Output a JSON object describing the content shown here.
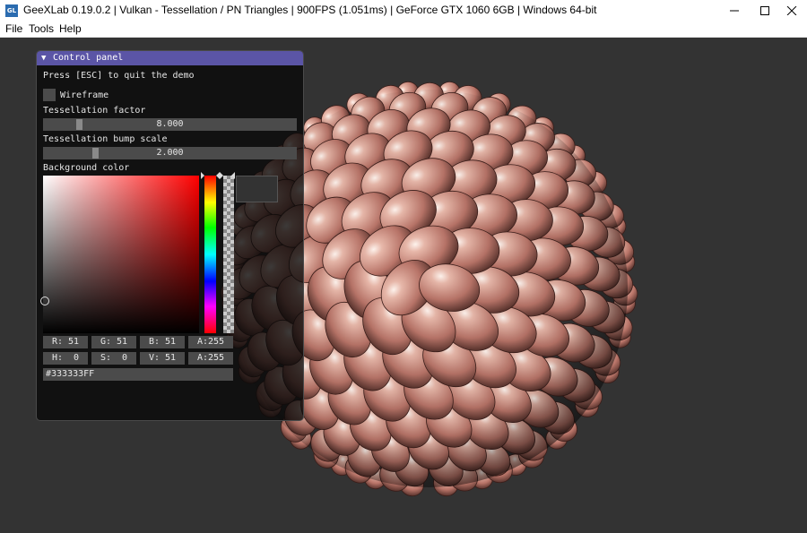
{
  "window": {
    "app_icon_text": "GL",
    "title": "GeeXLab 0.19.0.2 | Vulkan - Tessellation / PN Triangles | 900FPS (1.051ms) | GeForce GTX 1060 6GB | Windows 64-bit"
  },
  "menu": {
    "items": [
      {
        "label": "File"
      },
      {
        "label": "Tools"
      },
      {
        "label": "Help"
      }
    ]
  },
  "control_panel": {
    "title": "Control panel",
    "collapse_arrow": "▼",
    "hint": "Press [ESC] to quit the demo",
    "wireframe": {
      "label": "Wireframe",
      "checked": false
    },
    "tessellation_factor": {
      "label": "Tessellation factor",
      "value": "8.000",
      "fraction": 0.133
    },
    "tessellation_bump_scale": {
      "label": "Tessellation bump scale",
      "value": "2.000",
      "fraction": 0.2
    },
    "background_color": {
      "label": "Background color",
      "rgba": {
        "r": "R: 51",
        "g": "G: 51",
        "b": "B: 51",
        "a": "A:255"
      },
      "hsva": {
        "h": "H:  0",
        "s": "S:  0",
        "v": "V: 51",
        "a": "A:255"
      },
      "hex": "#333333FF",
      "color": "#333333"
    }
  },
  "colors": {
    "title_bar_bg": "#ffffff",
    "panel_header": "#5b55a6",
    "viewport_bg": "#333333",
    "petal_base": "#c48478"
  }
}
